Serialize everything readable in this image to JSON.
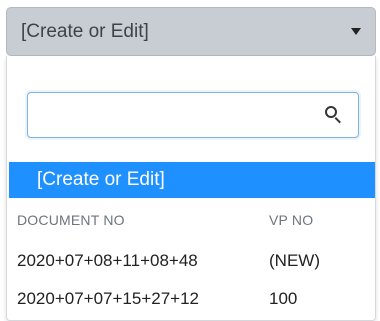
{
  "select": {
    "value": "[Create or Edit]"
  },
  "search": {
    "value": "",
    "placeholder": ""
  },
  "dropdown": {
    "selected_option": "[Create or Edit]",
    "columns": [
      "DOCUMENT NO",
      "VP NO"
    ],
    "rows": [
      {
        "document_no": "2020+07+08+11+08+48",
        "vp_no": "(NEW)"
      },
      {
        "document_no": "2020+07+07+15+27+12",
        "vp_no": "100"
      }
    ]
  },
  "colors": {
    "toggle_background": "#c8cdd4",
    "selected_option_background": "#1e90ff",
    "search_border": "#7fb2e5"
  },
  "icons": {
    "caret": "caret-down-icon",
    "search": "search-icon"
  }
}
